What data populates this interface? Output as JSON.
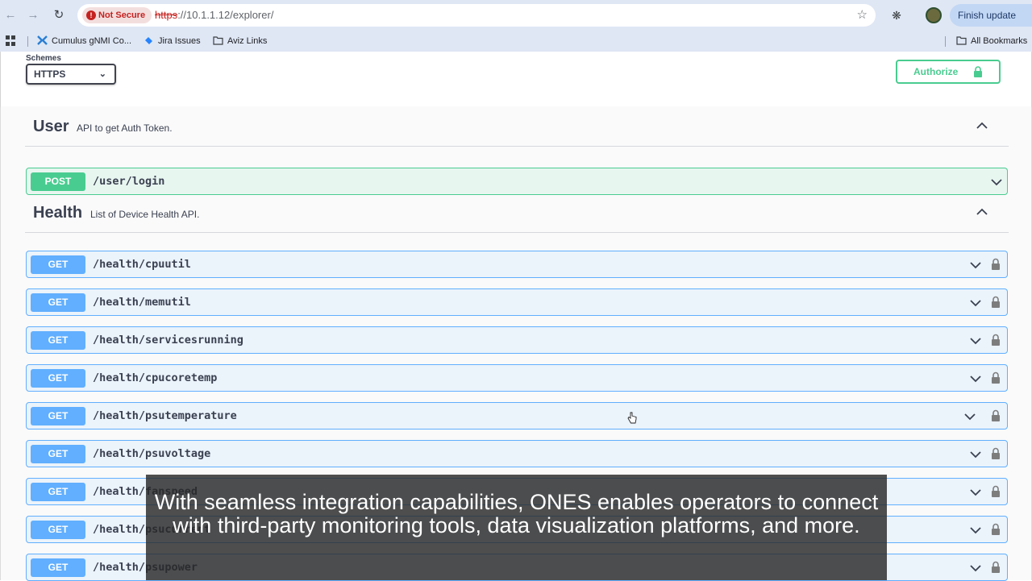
{
  "browser": {
    "not_secure_label": "Not Secure",
    "url_scheme": "https",
    "url_rest": "://10.1.1.12/explorer/",
    "finish_update_label": "Finish update",
    "bookmarks": [
      {
        "label": "Cumulus gNMI Co..."
      },
      {
        "label": "Jira Issues"
      },
      {
        "label": "Aviz Links"
      }
    ],
    "all_bookmarks_label": "All Bookmarks"
  },
  "toolbar": {
    "schemes_label": "Schemes",
    "scheme_selected": "HTTPS",
    "authorize_label": "Authorize"
  },
  "colors": {
    "post": "#49cc90",
    "get": "#61affe",
    "lock_green": "#49cc90"
  },
  "sections": {
    "user": {
      "title": "User",
      "description": "API to get Auth Token.",
      "operations": [
        {
          "method": "POST",
          "path": "/user/login"
        }
      ]
    },
    "health": {
      "title": "Health",
      "description": "List of Device Health API.",
      "operations": [
        {
          "method": "GET",
          "path": "/health/cpuutil"
        },
        {
          "method": "GET",
          "path": "/health/memutil"
        },
        {
          "method": "GET",
          "path": "/health/servicesrunning"
        },
        {
          "method": "GET",
          "path": "/health/cpucoretemp"
        },
        {
          "method": "GET",
          "path": "/health/psutemperature"
        },
        {
          "method": "GET",
          "path": "/health/psuvoltage"
        },
        {
          "method": "GET",
          "path": "/health/fanspeed"
        },
        {
          "method": "GET",
          "path": "/health/psucurrent"
        },
        {
          "method": "GET",
          "path": "/health/psupower"
        }
      ]
    }
  },
  "caption": {
    "text": "With seamless integration capabilities, ONES enables operators to connect with third-party monitoring tools, data visualization platforms, and more."
  }
}
